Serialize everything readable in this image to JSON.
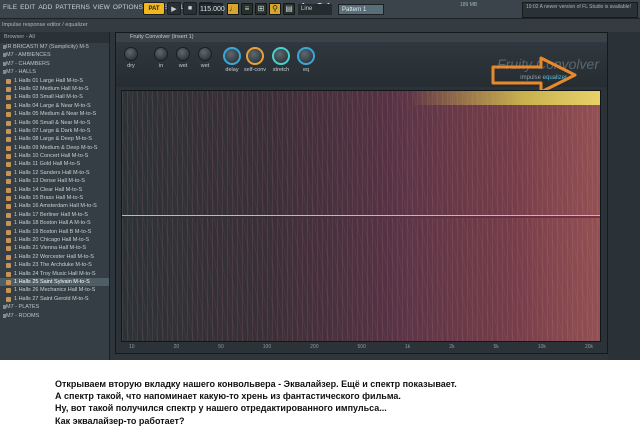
{
  "menu": [
    "FILE",
    "EDIT",
    "ADD",
    "PATTERNS",
    "VIEW",
    "OPTIONS",
    "TOOLS",
    "HELP"
  ],
  "transport": {
    "pat": "PAT",
    "tempo": "115.000",
    "time": "1:01",
    "time_small": "00",
    "cpu": "189 MB",
    "news": "19:02  A newer version of FL Studio is available!"
  },
  "toolbar": {
    "hint": "Impulse response editor / equalizer",
    "snap": "Line",
    "pattern": "Pattern 1"
  },
  "browser": {
    "header": "Browser - All",
    "items": [
      {
        "t": "IR BRICASTI M7 (Samplicity) M-5",
        "k": "folder"
      },
      {
        "t": "M7 - AMBIENCES",
        "k": "folder"
      },
      {
        "t": "M7 - CHAMBERS",
        "k": "folder"
      },
      {
        "t": "M7 - HALLS",
        "k": "folder"
      },
      {
        "t": "1 Halls 01 Large Hall  M-to-S",
        "k": "file"
      },
      {
        "t": "1 Halls 02 Medium Hall  M-to-S",
        "k": "file"
      },
      {
        "t": "1 Halls 03 Small Hall  M-to-S",
        "k": "file"
      },
      {
        "t": "1 Halls 04 Large & Near  M-to-S",
        "k": "file"
      },
      {
        "t": "1 Halls 05 Medium & Near  M-to-S",
        "k": "file"
      },
      {
        "t": "1 Halls 06 Small & Near  M-to-S",
        "k": "file"
      },
      {
        "t": "1 Halls 07 Large & Dark  M-to-S",
        "k": "file"
      },
      {
        "t": "1 Halls 08 Large & Deep  M-to-S",
        "k": "file"
      },
      {
        "t": "1 Halls 09 Medium & Deep  M-to-S",
        "k": "file"
      },
      {
        "t": "1 Halls 10 Concert Hall  M-to-S",
        "k": "file"
      },
      {
        "t": "1 Halls 11 Gold Hall  M-to-S",
        "k": "file"
      },
      {
        "t": "1 Halls 12 Sanders Hall  M-to-S",
        "k": "file"
      },
      {
        "t": "1 Halls 13 Dense Hall  M-to-S",
        "k": "file"
      },
      {
        "t": "1 Halls 14 Clear Hall  M-to-S",
        "k": "file"
      },
      {
        "t": "1 Halls 15 Brass Hall  M-to-S",
        "k": "file"
      },
      {
        "t": "1 Halls 16 Amsterdam Hall  M-to-S",
        "k": "file"
      },
      {
        "t": "1 Halls 17 Berliner Hall  M-to-S",
        "k": "file"
      },
      {
        "t": "1 Halls 18 Boston Hall A  M-to-S",
        "k": "file"
      },
      {
        "t": "1 Halls 19 Boston Hall B  M-to-S",
        "k": "file"
      },
      {
        "t": "1 Halls 20 Chicago Hall  M-to-S",
        "k": "file"
      },
      {
        "t": "1 Halls 21 Vienna Hall  M-to-S",
        "k": "file"
      },
      {
        "t": "1 Halls 22 Worcester Hall  M-to-S",
        "k": "file"
      },
      {
        "t": "1 Halls 23 The Archduke  M-to-S",
        "k": "file"
      },
      {
        "t": "1 Halls 24 Troy Music Hall  M-to-S",
        "k": "file"
      },
      {
        "t": "1 Halls 25 Saint Sylvain  M-to-S",
        "k": "file",
        "sel": true
      },
      {
        "t": "1 Halls 26 Mechanics Hall  M-to-S",
        "k": "file"
      },
      {
        "t": "1 Halls 27 Saint Gerold  M-to-S",
        "k": "file"
      },
      {
        "t": "M7 - PLATES",
        "k": "folder"
      },
      {
        "t": "M7 - ROOMS",
        "k": "folder"
      }
    ]
  },
  "plugin": {
    "title": "Fruity Convolver (Insert 1)",
    "brand": "Fruity Convolver",
    "tab_impulse": "impulse",
    "tab_eq": "equalizer",
    "knobs": [
      "dry",
      "in",
      "wet",
      "wet",
      "delay",
      "self-conv",
      "stretch",
      "eq"
    ],
    "freqs": [
      "10",
      "20",
      "50",
      "100",
      "200",
      "500",
      "1k",
      "2k",
      "5k",
      "10k",
      "20k"
    ]
  },
  "colors": {
    "arrow": "#e8892b",
    "eq_tab": "#5fbde0",
    "midline": "#9fc4d6"
  },
  "caption": [
    "Открываем вторую вкладку нашего конвольвера - Эквалайзер. Ещё и спектр показывает.",
    "А спектр такой, что напоминает какую-то хрень из фантастического фильма.",
    "Ну, вот такой получился спектр у нашего отредактированного импульса...",
    "Как эквалайзер-то работает?"
  ]
}
